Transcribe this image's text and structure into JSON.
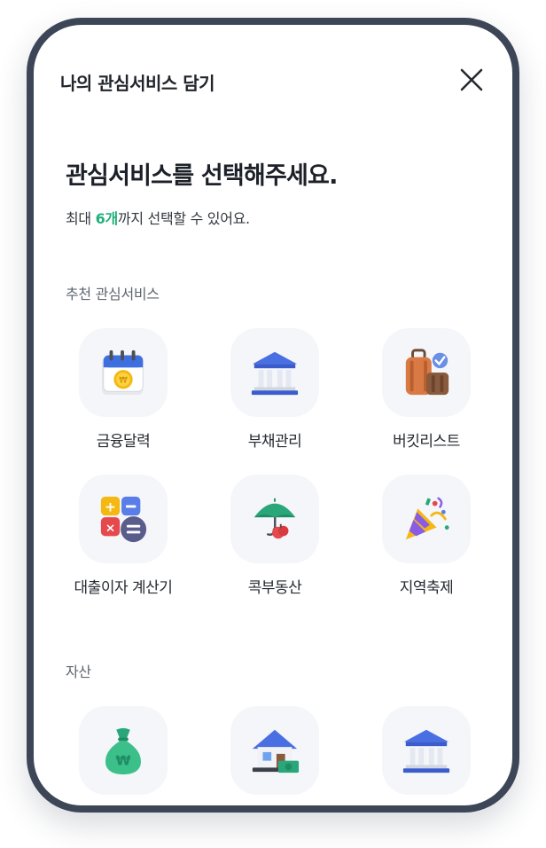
{
  "header": {
    "title": "나의 관심서비스 담기",
    "close_icon": "close-icon"
  },
  "intro": {
    "heading": "관심서비스를 선택해주세요.",
    "sub_prefix": "최대 ",
    "sub_count": "6개",
    "sub_suffix": "까지 선택할 수 있어요."
  },
  "recommended": {
    "title": "추천 관심서비스",
    "items": [
      {
        "label": "금융달력",
        "icon": "calendar-coin-icon"
      },
      {
        "label": "부채관리",
        "icon": "bank-building-icon"
      },
      {
        "label": "버킷리스트",
        "icon": "suitcase-icon"
      },
      {
        "label": "대출이자 계산기",
        "icon": "calculator-icon"
      },
      {
        "label": "콕부동산",
        "icon": "umbrella-house-icon"
      },
      {
        "label": "지역축제",
        "icon": "party-popper-icon"
      }
    ]
  },
  "assets": {
    "title": "자산",
    "items": [
      {
        "icon": "money-bag-icon"
      },
      {
        "icon": "house-money-icon"
      },
      {
        "icon": "bank-building-icon"
      }
    ]
  },
  "colors": {
    "accent": "#20b07a",
    "frame": "#3c4656"
  }
}
